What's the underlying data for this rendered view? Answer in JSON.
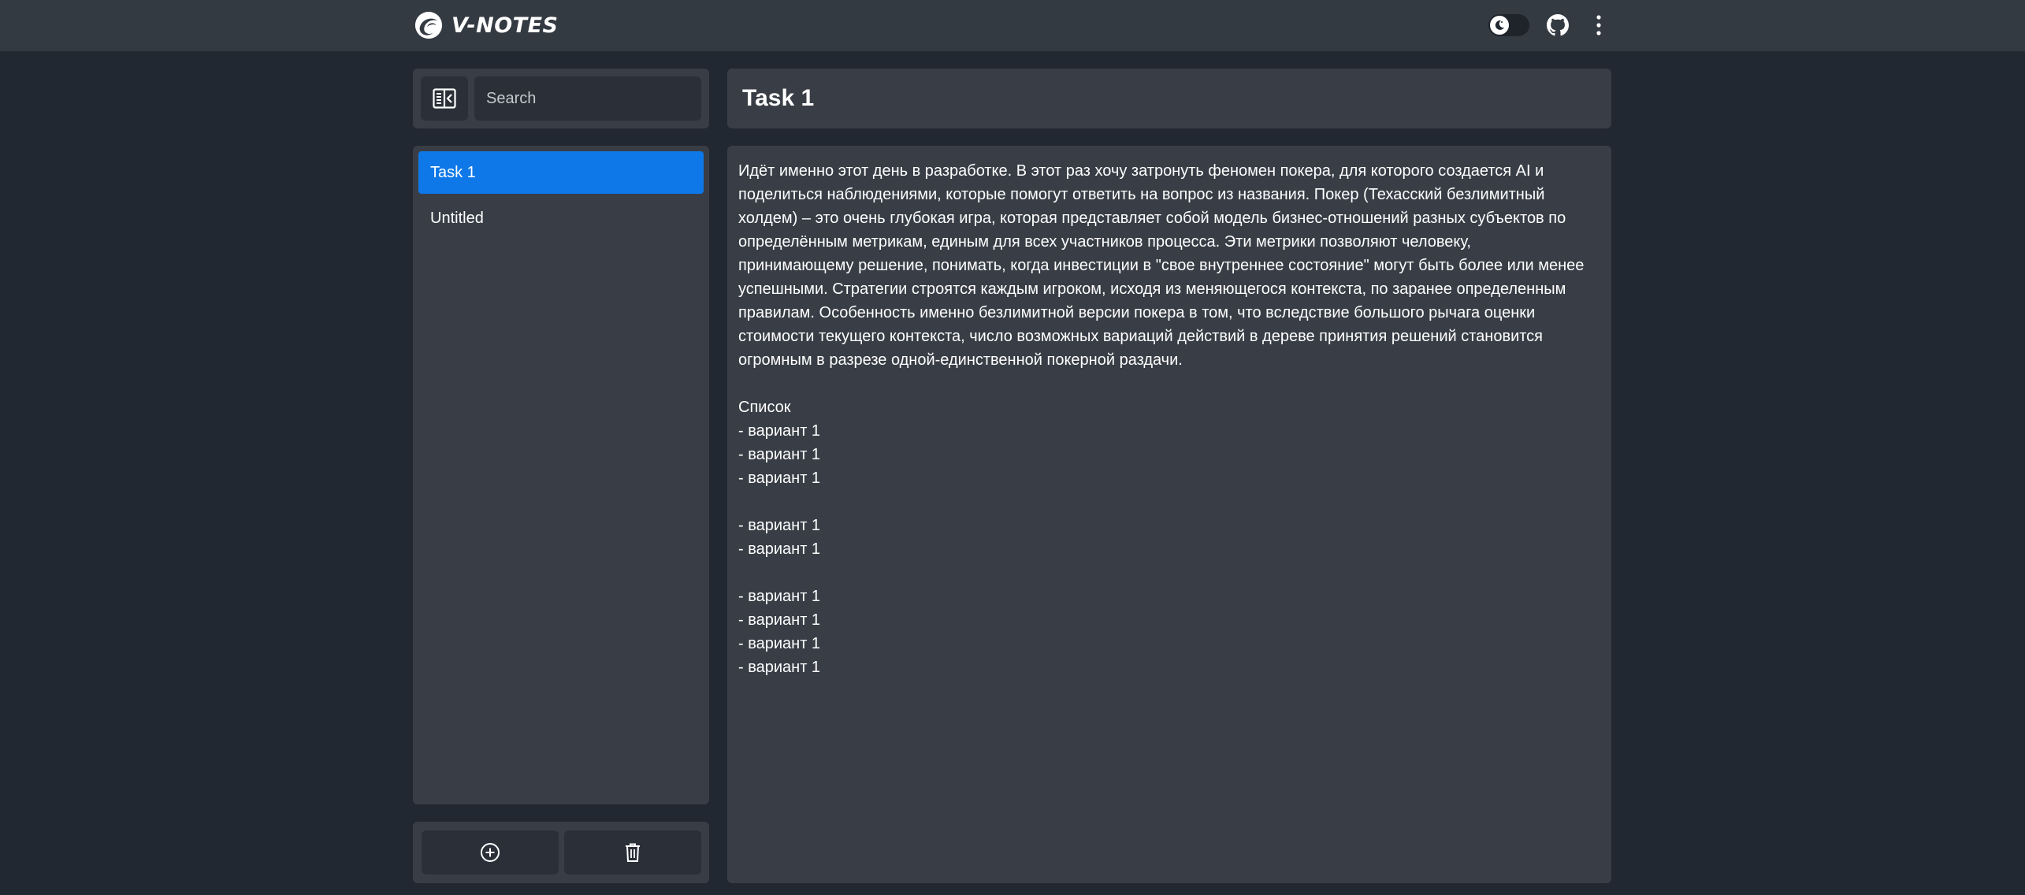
{
  "header": {
    "app_name": "V-NOTES"
  },
  "sidebar": {
    "search": {
      "placeholder": "Search",
      "value": ""
    },
    "notes": [
      {
        "label": "Task 1",
        "active": true
      },
      {
        "label": "Untitled",
        "active": false
      }
    ]
  },
  "note": {
    "title": "Task 1",
    "lines": [
      "Идёт именно этот день в разработке. В этот раз хочу затронуть феномен покера, для которого создается AI и",
      "поделиться наблюдениями, которые помогут ответить на вопрос из названия. Покер (Техасский безлимитный",
      "холдем) – это очень глубокая игра, которая представляет собой модель бизнес-отношений разных субъектов по",
      "определённым метрикам, единым для всех участников процесса. Эти метрики позволяют человеку,",
      "принимающему решение, понимать, когда инвестиции в \"свое внутреннее состояние\" могут быть более или менее",
      "успешными. Стратегии строятся каждым игроком, исходя из меняющегося контекста, по заранее определенным",
      "правилам. Особенность именно безлимитной версии покера в том, что вследствие большого рычага оценки",
      "стоимости текущего контекста, число возможных вариаций действий в дереве принятия решений становится",
      "огромным в разрезе одной-единственной покерной раздачи.",
      "",
      "Список",
      "- вариант 1",
      "- вариант 1",
      "- вариант 1",
      "",
      "- вариант 1",
      "- вариант 1",
      "",
      "- вариант 1",
      "- вариант 1",
      "- вариант 1",
      "- вариант 1"
    ]
  },
  "icons": {
    "logo": "logo-icon",
    "theme": "moon-icon",
    "github": "github-icon",
    "menu": "more-vertical-icon",
    "sidebar_toggle": "sidebar-collapse-icon",
    "add": "plus-circle-icon",
    "delete": "trash-icon"
  },
  "colors": {
    "background": "#222831",
    "panel": "#393e46",
    "header": "#343a42",
    "accent": "#0e78e8"
  }
}
